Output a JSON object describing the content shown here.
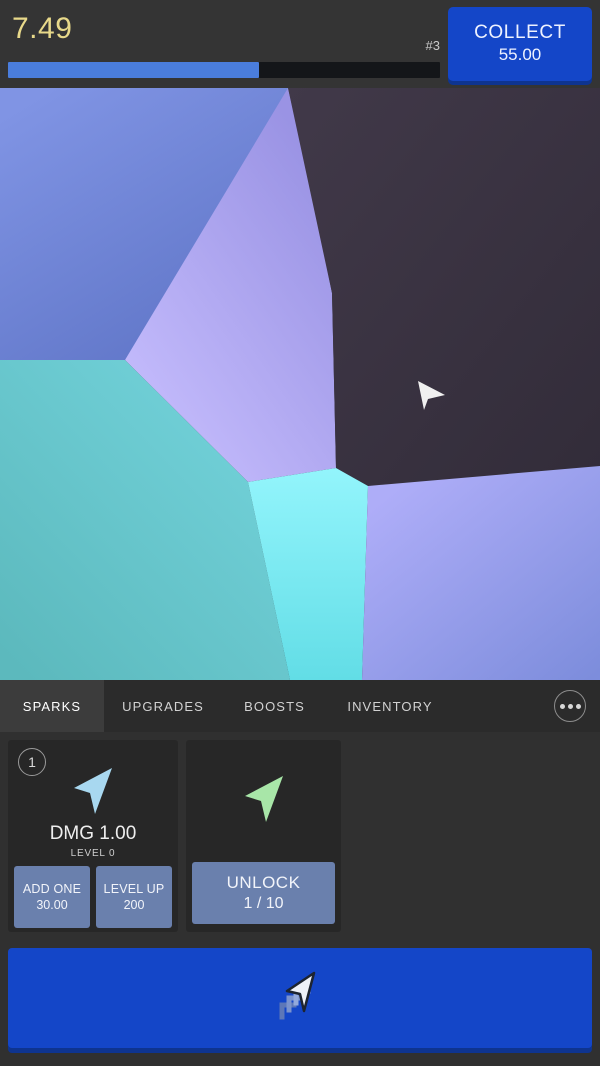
{
  "topbar": {
    "score": "7.49",
    "rank": "#3",
    "progress_percent": 58,
    "collect": {
      "label": "COLLECT",
      "amount": "55.00"
    },
    "accent_color": "#1446c8",
    "score_color": "#e8d98a",
    "progress_fill_color": "#4a7ddc"
  },
  "game": {
    "cursor_icon": "cursor-arrow",
    "cells": [
      {
        "name": "cell-periwinkle-top-left",
        "color_from": "#7a8fe0",
        "color_to": "#6074c6"
      },
      {
        "name": "cell-lavender-center",
        "color_from": "#c7bdff",
        "color_to": "#9d96e8"
      },
      {
        "name": "cell-dark-right",
        "color_from": "#3f3747",
        "color_to": "#332d3a"
      },
      {
        "name": "cell-teal-left",
        "color_from": "#6ccfd9",
        "color_to": "#5fbfbf"
      },
      {
        "name": "cell-cyan-center",
        "color_from": "#8df3fb",
        "color_to": "#66dfe6"
      },
      {
        "name": "cell-blue-right",
        "color_from": "#a9a8f7",
        "color_to": "#7f8fdd"
      }
    ]
  },
  "tabs": {
    "items": [
      {
        "label": "SPARKS",
        "active": true
      },
      {
        "label": "UPGRADES",
        "active": false
      },
      {
        "label": "BOOSTS",
        "active": false
      },
      {
        "label": "INVENTORY",
        "active": false
      }
    ],
    "more_icon": "ellipsis-icon"
  },
  "cards": [
    {
      "type": "spark",
      "slot": "1",
      "icon": "cursor-arrow-icon",
      "icon_color": "#a8d8f0",
      "title": "DMG 1.00",
      "level": "LEVEL 0",
      "actions": [
        {
          "name": "add-one-button",
          "label": "ADD ONE",
          "cost": "30.00"
        },
        {
          "name": "level-up-button",
          "label": "LEVEL UP",
          "cost": "200"
        }
      ]
    },
    {
      "type": "locked",
      "icon": "cursor-arrow-icon",
      "icon_color": "#a8e6a8",
      "actions": [
        {
          "name": "unlock-button",
          "label": "UNLOCK",
          "cost": "1 / 10"
        }
      ]
    }
  ],
  "big_action": {
    "name": "spawn-spark-button",
    "icon": "cursor-stack-icon",
    "color": "#1446c8"
  }
}
